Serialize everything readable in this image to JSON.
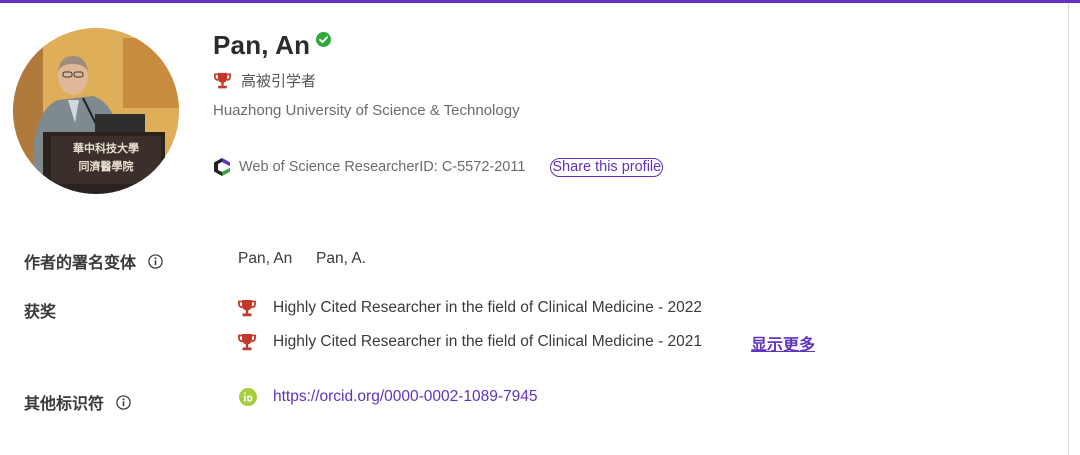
{
  "profile": {
    "name": "Pan, An",
    "highly_cited_label": "高被引学者",
    "affiliation": "Huazhong University of Science & Technology",
    "researcher_id": "Web of Science ResearcherID: C-5572-2011",
    "share_label": "Share this profile",
    "photo_banner_line1": "華中科技大學",
    "photo_banner_line2": "同濟醫學院"
  },
  "fields": {
    "name_variants": {
      "label": "作者的署名变体",
      "values": [
        "Pan, An",
        "Pan, A."
      ]
    },
    "awards": {
      "label": "获奖",
      "items": [
        "Highly Cited Researcher in the field of Clinical Medicine - 2022",
        "Highly Cited Researcher in the field of Clinical Medicine - 2021"
      ],
      "show_more_label": "显示更多"
    },
    "other_identifiers": {
      "label": "其他标识符",
      "orcid_url": "https://orcid.org/0000-0002-1089-7945"
    }
  },
  "colors": {
    "accent": "#5e33bf",
    "trophy": "#c0392b",
    "verified": "#2eaa3b",
    "orcid": "#a6ce39"
  }
}
